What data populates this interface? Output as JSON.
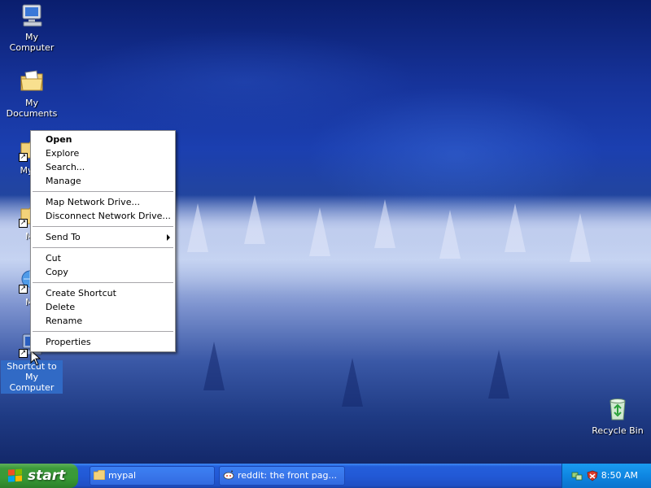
{
  "desktop": {
    "icons": [
      {
        "label": "My Computer",
        "icon": "my-computer-icon"
      },
      {
        "label": "My Documents",
        "icon": "my-documents-icon"
      },
      {
        "label": "My Pi",
        "icon": "folder-shortcut-icon"
      },
      {
        "label": "My",
        "icon": "folder-shortcut-icon"
      },
      {
        "label": "My",
        "icon": "network-shortcut-icon"
      },
      {
        "label": "Shortcut to My Computer",
        "icon": "computer-shortcut-icon"
      },
      {
        "label": "Recycle Bin",
        "icon": "recycle-bin-icon"
      }
    ]
  },
  "context_menu": {
    "items": [
      {
        "label": "Open"
      },
      {
        "label": "Explore"
      },
      {
        "label": "Search..."
      },
      {
        "label": "Manage"
      },
      {
        "label": "Map Network Drive..."
      },
      {
        "label": "Disconnect Network Drive..."
      },
      {
        "label": "Send To"
      },
      {
        "label": "Cut"
      },
      {
        "label": "Copy"
      },
      {
        "label": "Create Shortcut"
      },
      {
        "label": "Delete"
      },
      {
        "label": "Rename"
      },
      {
        "label": "Properties"
      }
    ]
  },
  "taskbar": {
    "start_label": "start",
    "tasks": [
      {
        "label": "mypal",
        "icon": "folder-icon"
      },
      {
        "label": "reddit: the front pag...",
        "icon": "reddit-alien-icon"
      }
    ],
    "clock": "8:50 AM"
  },
  "colors": {
    "taskbar_blue": "#245edb",
    "start_green": "#3c9a3a",
    "tray_blue": "#0e86e2",
    "selection_blue": "#316ac5"
  }
}
